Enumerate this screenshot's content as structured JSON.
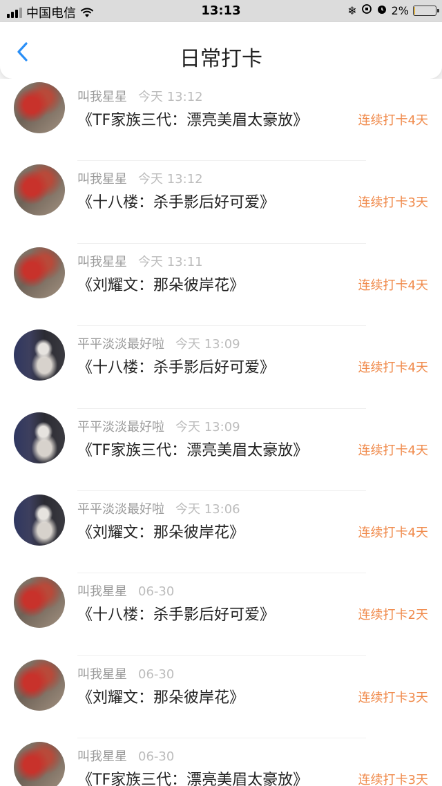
{
  "status_bar": {
    "carrier": "中国电信",
    "time": "13:13",
    "battery_percent": "2%",
    "battery_level": 0.02
  },
  "nav": {
    "title": "日常打卡"
  },
  "records": [
    {
      "user": "叫我星星",
      "time": "今天 13:12",
      "book": "《TF家族三代：漂亮美眉太豪放》",
      "streak": "连续打卡4天",
      "avatar": "xingxing"
    },
    {
      "user": "叫我星星",
      "time": "今天 13:12",
      "book": "《十八楼：杀手影后好可爱》",
      "streak": "连续打卡3天",
      "avatar": "xingxing"
    },
    {
      "user": "叫我星星",
      "time": "今天 13:11",
      "book": "《刘耀文：那朵彼岸花》",
      "streak": "连续打卡4天",
      "avatar": "xingxing"
    },
    {
      "user": "平平淡淡最好啦",
      "time": "今天 13:09",
      "book": "《十八楼：杀手影后好可爱》",
      "streak": "连续打卡4天",
      "avatar": "pingping"
    },
    {
      "user": "平平淡淡最好啦",
      "time": "今天 13:09",
      "book": "《TF家族三代：漂亮美眉太豪放》",
      "streak": "连续打卡4天",
      "avatar": "pingping"
    },
    {
      "user": "平平淡淡最好啦",
      "time": "今天 13:06",
      "book": "《刘耀文：那朵彼岸花》",
      "streak": "连续打卡4天",
      "avatar": "pingping"
    },
    {
      "user": "叫我星星",
      "time": "06-30",
      "book": "《十八楼：杀手影后好可爱》",
      "streak": "连续打卡2天",
      "avatar": "xingxing"
    },
    {
      "user": "叫我星星",
      "time": "06-30",
      "book": "《刘耀文：那朵彼岸花》",
      "streak": "连续打卡3天",
      "avatar": "xingxing"
    },
    {
      "user": "叫我星星",
      "time": "06-30",
      "book": "《TF家族三代：漂亮美眉太豪放》",
      "streak": "连续打卡3天",
      "avatar": "xingxing"
    }
  ],
  "colors": {
    "accent": "#2a8ff7",
    "streak": "#f08a4b"
  }
}
